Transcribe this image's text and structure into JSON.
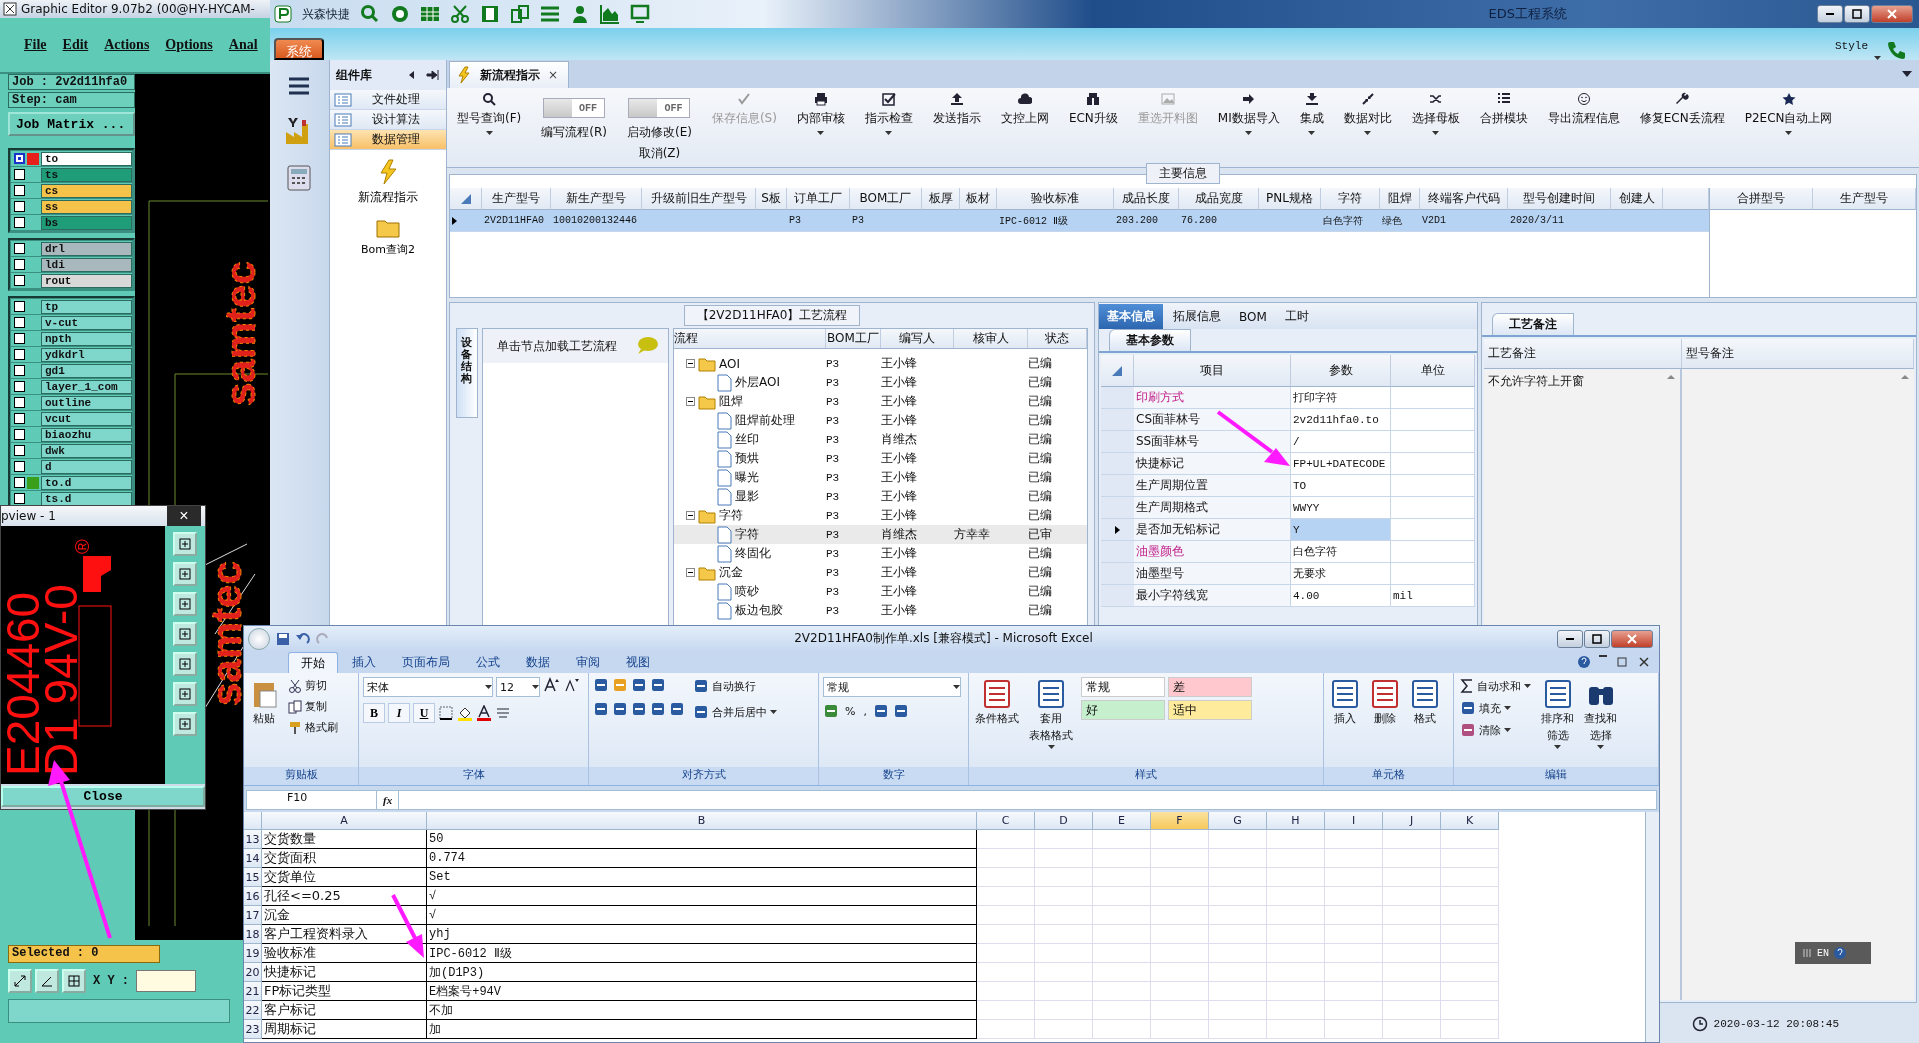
{
  "graphic_editor": {
    "title": "Graphic Editor 9.07b2 (00@HY-HYCAM-",
    "menu": [
      "File",
      "Edit",
      "Actions",
      "Options",
      "Anal"
    ],
    "job": "Job : 2v2d11hfa0",
    "step": "Step: cam",
    "job_matrix": "Job Matrix ...",
    "layer_groups": [
      [
        {
          "name": "to",
          "color": "#ffffff",
          "marker": {
            "color": "#e8201c"
          },
          "affected": true
        },
        {
          "name": "ts",
          "color": "#1f9c78",
          "affected": false
        },
        {
          "name": "cs",
          "color": "#f5c34a",
          "affected": false
        },
        {
          "name": "ss",
          "color": "#f5c34a",
          "affected": false
        },
        {
          "name": "bs",
          "color": "#1f9c78",
          "affected": false
        }
      ],
      [
        {
          "name": "drl",
          "color": "#a9b8bc",
          "affected": false
        },
        {
          "name": "ldi",
          "color": "#a9b8bc",
          "affected": false
        },
        {
          "name": "rout",
          "color": "#d9d9d9",
          "affected": false
        }
      ],
      [
        {
          "name": "tp",
          "color": "#7fd6cb",
          "affected": false
        },
        {
          "name": "v-cut",
          "color": "#7fd6cb",
          "affected": false
        },
        {
          "name": "npth",
          "color": "#7fd6cb",
          "affected": false
        },
        {
          "name": "ydkdrl",
          "color": "#7fd6cb",
          "affected": false
        },
        {
          "name": "gd1",
          "color": "#7fd6cb",
          "affected": false
        },
        {
          "name": "layer_1_com",
          "color": "#7fd6cb",
          "affected": false
        },
        {
          "name": "outline",
          "color": "#7fd6cb",
          "affected": false
        },
        {
          "name": "vcut",
          "color": "#7fd6cb",
          "affected": false
        },
        {
          "name": "biaozhu",
          "color": "#7fd6cb",
          "affected": false
        },
        {
          "name": "dwk",
          "color": "#7fd6cb",
          "affected": false
        },
        {
          "name": "d",
          "color": "#7fd6cb",
          "affected": false
        },
        {
          "name": "to.d",
          "color": "#7fd6cb",
          "marker": {
            "color": "#3aa01c"
          },
          "affected": false
        },
        {
          "name": "ts.d",
          "color": "#7fd6cb",
          "affected": false
        }
      ]
    ],
    "canvas_texts": [
      "samtec",
      "samtec"
    ],
    "selected_count": "Selected : 0",
    "xy_label": "X Y :"
  },
  "pview": {
    "title": "pview - 1",
    "close": "×",
    "lines": [
      "E204460",
      "D1 94V-0"
    ],
    "registered_mark": "®",
    "close_button": "Close"
  },
  "eds": {
    "title": "EDS工程系统",
    "quick_access": "兴森快捷",
    "system_tab": "系统",
    "style_menu": "Style",
    "library": {
      "title": "组件库",
      "items": [
        {
          "label": "文件处理",
          "selected": false
        },
        {
          "label": "设计算法",
          "selected": false
        },
        {
          "label": "数据管理",
          "selected": true
        }
      ],
      "tools": [
        "新流程指示",
        "Bom查询2"
      ]
    },
    "document_tab": {
      "label": "新流程指示",
      "close": "×"
    },
    "toolbar": [
      {
        "kind": "button",
        "label": "型号查询(F)",
        "menu": true,
        "disabled": false
      },
      {
        "kind": "toggle",
        "label": "编写流程(R)",
        "state_label": "OFF",
        "on": false
      },
      {
        "kind": "toggle",
        "label": "启动修改(E)",
        "sublabel": "取消(Z)",
        "state_label": "OFF",
        "on": false
      },
      {
        "kind": "button",
        "label": "保存信息(S)",
        "menu": false,
        "disabled": true
      },
      {
        "kind": "button",
        "label": "内部审核",
        "menu": true,
        "disabled": false
      },
      {
        "kind": "button",
        "label": "指示检查",
        "menu": true,
        "disabled": false
      },
      {
        "kind": "button",
        "label": "发送指示",
        "menu": false,
        "disabled": false
      },
      {
        "kind": "button",
        "label": "文控上网",
        "menu": false,
        "disabled": false
      },
      {
        "kind": "button",
        "label": "ECN升级",
        "menu": false,
        "disabled": false
      },
      {
        "kind": "button",
        "label": "重选开料图",
        "menu": false,
        "disabled": true
      },
      {
        "kind": "button",
        "label": "MI数据导入",
        "menu": true,
        "disabled": false
      },
      {
        "kind": "button",
        "label": "集成",
        "menu": true,
        "disabled": false
      },
      {
        "kind": "button",
        "label": "数据对比",
        "menu": true,
        "disabled": false
      },
      {
        "kind": "button",
        "label": "选择母板",
        "menu": true,
        "disabled": false
      },
      {
        "kind": "button",
        "label": "合拼模块",
        "menu": false,
        "disabled": false
      },
      {
        "kind": "button",
        "label": "导出流程信息",
        "menu": false,
        "disabled": false
      },
      {
        "kind": "button",
        "label": "修复ECN丢流程",
        "menu": false,
        "disabled": false
      },
      {
        "kind": "button",
        "label": "P2ECN自动上网",
        "menu": true,
        "disabled": false
      }
    ],
    "main_info": {
      "title": "主要信息",
      "columns": [
        "生产型号",
        "新生产型号",
        "升级前旧生产型号",
        "S板",
        "订单工厂",
        "BOM工厂",
        "板厚",
        "板材",
        "验收标准",
        "成品长度",
        "成品宽度",
        "PNL规格",
        "字符",
        "阻焊",
        "终端客户代码",
        "型号创建时间",
        "创建人"
      ],
      "rows": [
        {
          "selected": true,
          "cells": [
            "2V2D11HFA0",
            "10010200132446",
            "",
            "",
            "P3",
            "P3",
            "",
            "",
            "IPC-6012 Ⅱ级",
            "203.200",
            "76.200",
            "",
            "白色字符",
            "绿色",
            "V2D1",
            "2020/3/11",
            ""
          ]
        }
      ],
      "side_columns": [
        "合拼型号",
        "生产型号"
      ]
    },
    "process_flow": {
      "title": "【2V2D11HFA0】工艺流程",
      "side_tab": "设备结构",
      "hint": "单击节点加载工艺流程",
      "columns": [
        "流程",
        "BOM工厂",
        "编写人",
        "核审人",
        "状态"
      ],
      "tree": [
        {
          "label": "AOI",
          "kind": "folder",
          "expanded": true,
          "factory": "P3",
          "author": "王小锋",
          "status": "已编",
          "selected": false,
          "children": [
            {
              "label": "外层AOI",
              "kind": "step",
              "factory": "P3",
              "author": "王小锋",
              "status": "已编",
              "selected": false
            }
          ]
        },
        {
          "label": "阻焊",
          "kind": "folder",
          "expanded": true,
          "factory": "P3",
          "author": "王小锋",
          "status": "已编",
          "selected": false,
          "children": [
            {
              "label": "阻焊前处理",
              "kind": "step",
              "factory": "P3",
              "author": "王小锋",
              "status": "已编",
              "selected": false
            },
            {
              "label": "丝印",
              "kind": "step",
              "factory": "P3",
              "author": "肖维杰",
              "status": "已编",
              "selected": false
            },
            {
              "label": "预烘",
              "kind": "step",
              "factory": "P3",
              "author": "王小锋",
              "status": "已编",
              "selected": false
            },
            {
              "label": "曝光",
              "kind": "step",
              "factory": "P3",
              "author": "王小锋",
              "status": "已编",
              "selected": false
            },
            {
              "label": "显影",
              "kind": "step",
              "factory": "P3",
              "author": "王小锋",
              "status": "已编",
              "selected": false
            }
          ]
        },
        {
          "label": "字符",
          "kind": "folder",
          "expanded": true,
          "factory": "P3",
          "author": "王小锋",
          "status": "已编",
          "selected": false,
          "children": [
            {
              "label": "字符",
              "kind": "step",
              "factory": "P3",
              "author": "肖维杰",
              "reviewer": "方幸幸",
              "status": "已审",
              "selected": true
            },
            {
              "label": "终固化",
              "kind": "step",
              "factory": "P3",
              "author": "王小锋",
              "status": "已编",
              "selected": false
            }
          ]
        },
        {
          "label": "沉金",
          "kind": "folder",
          "expanded": true,
          "factory": "P3",
          "author": "王小锋",
          "status": "已编",
          "selected": false,
          "children": [
            {
              "label": "喷砂",
              "kind": "step",
              "factory": "P3",
              "author": "王小锋",
              "status": "已编",
              "selected": false
            },
            {
              "label": "板边包胶",
              "kind": "step",
              "factory": "P3",
              "author": "王小锋",
              "status": "已编",
              "selected": false
            }
          ]
        }
      ]
    },
    "basic_info": {
      "tabs": [
        {
          "label": "基本信息",
          "selected": true
        },
        {
          "label": "拓展信息",
          "selected": false
        },
        {
          "label": "BOM",
          "selected": false
        },
        {
          "label": "工时",
          "selected": false
        }
      ],
      "subtab": "基本参数",
      "columns": [
        "项目",
        "参数",
        "单位"
      ],
      "rows": [
        {
          "item": "印刷方式",
          "value": "打印字符",
          "emphasized": true,
          "selected": false
        },
        {
          "item": "CS面菲林号",
          "value": "2v2d11hfa0.to",
          "emphasized": false,
          "selected": false
        },
        {
          "item": "SS面菲林号",
          "value": "/",
          "emphasized": false,
          "selected": false
        },
        {
          "item": "快捷标记",
          "value": "FP+UL+DATECODE",
          "emphasized": false,
          "selected": false
        },
        {
          "item": "生产周期位置",
          "value": "TO",
          "emphasized": false,
          "selected": false
        },
        {
          "item": "生产周期格式",
          "value": "WWYY",
          "emphasized": false,
          "selected": false
        },
        {
          "item": "是否加无铅标记",
          "value": "Y",
          "emphasized": false,
          "selected": true
        },
        {
          "item": "油墨颜色",
          "value": "白色字符",
          "emphasized": true,
          "selected": false
        },
        {
          "item": "油墨型号",
          "value": "无要求",
          "emphasized": false,
          "selected": false
        },
        {
          "item": "最小字符线宽",
          "value": "4.00",
          "unit": "mil",
          "emphasized": false,
          "selected": false
        }
      ]
    },
    "process_notes": {
      "tab": "工艺备注",
      "columns": [
        "工艺备注",
        "型号备注"
      ],
      "note": "不允许字符上开窗"
    },
    "clock": "2020-03-12 20:08:45"
  },
  "excel": {
    "title": "2V2D11HFA0制作单.xls  [兼容模式] - Microsoft Excel",
    "tabs": [
      {
        "label": "开始",
        "selected": true
      },
      {
        "label": "插入",
        "selected": false
      },
      {
        "label": "页面布局",
        "selected": false
      },
      {
        "label": "公式",
        "selected": false
      },
      {
        "label": "数据",
        "selected": false
      },
      {
        "label": "审阅",
        "selected": false
      },
      {
        "label": "视图",
        "selected": false
      }
    ],
    "clipboard": {
      "label": "剪贴板",
      "paste": "粘贴",
      "cut": "剪切",
      "copy": "复制",
      "format_painter": "格式刷"
    },
    "font": {
      "label": "字体",
      "name": "宋体",
      "size": "12",
      "bold": "B",
      "italic": "I",
      "underline": "U"
    },
    "alignment": {
      "label": "对齐方式",
      "wrap": "自动换行",
      "merge": "合并后居中"
    },
    "number": {
      "label": "数字",
      "format": "常规",
      "percent": "%",
      "comma": ","
    },
    "styles": {
      "label": "样式",
      "conditional": "条件格式",
      "table_format": "套用",
      "table_format_2": "表格格式",
      "cells": [
        {
          "text": "常规",
          "color": "#ffffff"
        },
        {
          "text": "差",
          "color": "#ffc7ce"
        },
        {
          "text": "好",
          "color": "#c6efce"
        },
        {
          "text": "适中",
          "color": "#ffeb9c"
        }
      ]
    },
    "cells": {
      "label": "单元格",
      "insert": "插入",
      "delete": "删除",
      "format": "格式"
    },
    "editing": {
      "label": "编辑",
      "autosum": "自动求和",
      "fill": "填充",
      "clear": "清除",
      "sort": "排序和",
      "sort_2": "筛选",
      "find": "查找和",
      "find_2": "选择"
    },
    "name_box": "F10",
    "fx": "fx",
    "columns": [
      {
        "label": "A",
        "selected": false
      },
      {
        "label": "B",
        "selected": false
      },
      {
        "label": "C",
        "selected": false
      },
      {
        "label": "D",
        "selected": false
      },
      {
        "label": "E",
        "selected": false
      },
      {
        "label": "F",
        "selected": true
      },
      {
        "label": "G",
        "selected": false
      },
      {
        "label": "H",
        "selected": false
      },
      {
        "label": "I",
        "selected": false
      },
      {
        "label": "J",
        "selected": false
      },
      {
        "label": "K",
        "selected": false
      }
    ],
    "rows": [
      {
        "row": "13",
        "a": "交货数量",
        "b": "50"
      },
      {
        "row": "14",
        "a": "交货面积",
        "b": "0.774"
      },
      {
        "row": "15",
        "a": "交货单位",
        "b": "Set"
      },
      {
        "row": "16",
        "a": "孔径<=0.25",
        "b": "√"
      },
      {
        "row": "17",
        "a": "沉金",
        "b": "√"
      },
      {
        "row": "18",
        "a": "客户工程资料录入",
        "b": "yhj"
      },
      {
        "row": "19",
        "a": "验收标准",
        "b": "IPC-6012 Ⅱ级"
      },
      {
        "row": "20",
        "a": "快捷标记",
        "b": "加(D1P3)"
      },
      {
        "row": "21",
        "a": "FP标记类型",
        "b": "E档案号+94V"
      },
      {
        "row": "22",
        "a": "客户标记",
        "b": "不加"
      },
      {
        "row": "23",
        "a": "周期标记",
        "b": "加"
      }
    ]
  },
  "language_bar": {
    "language": "EN"
  }
}
